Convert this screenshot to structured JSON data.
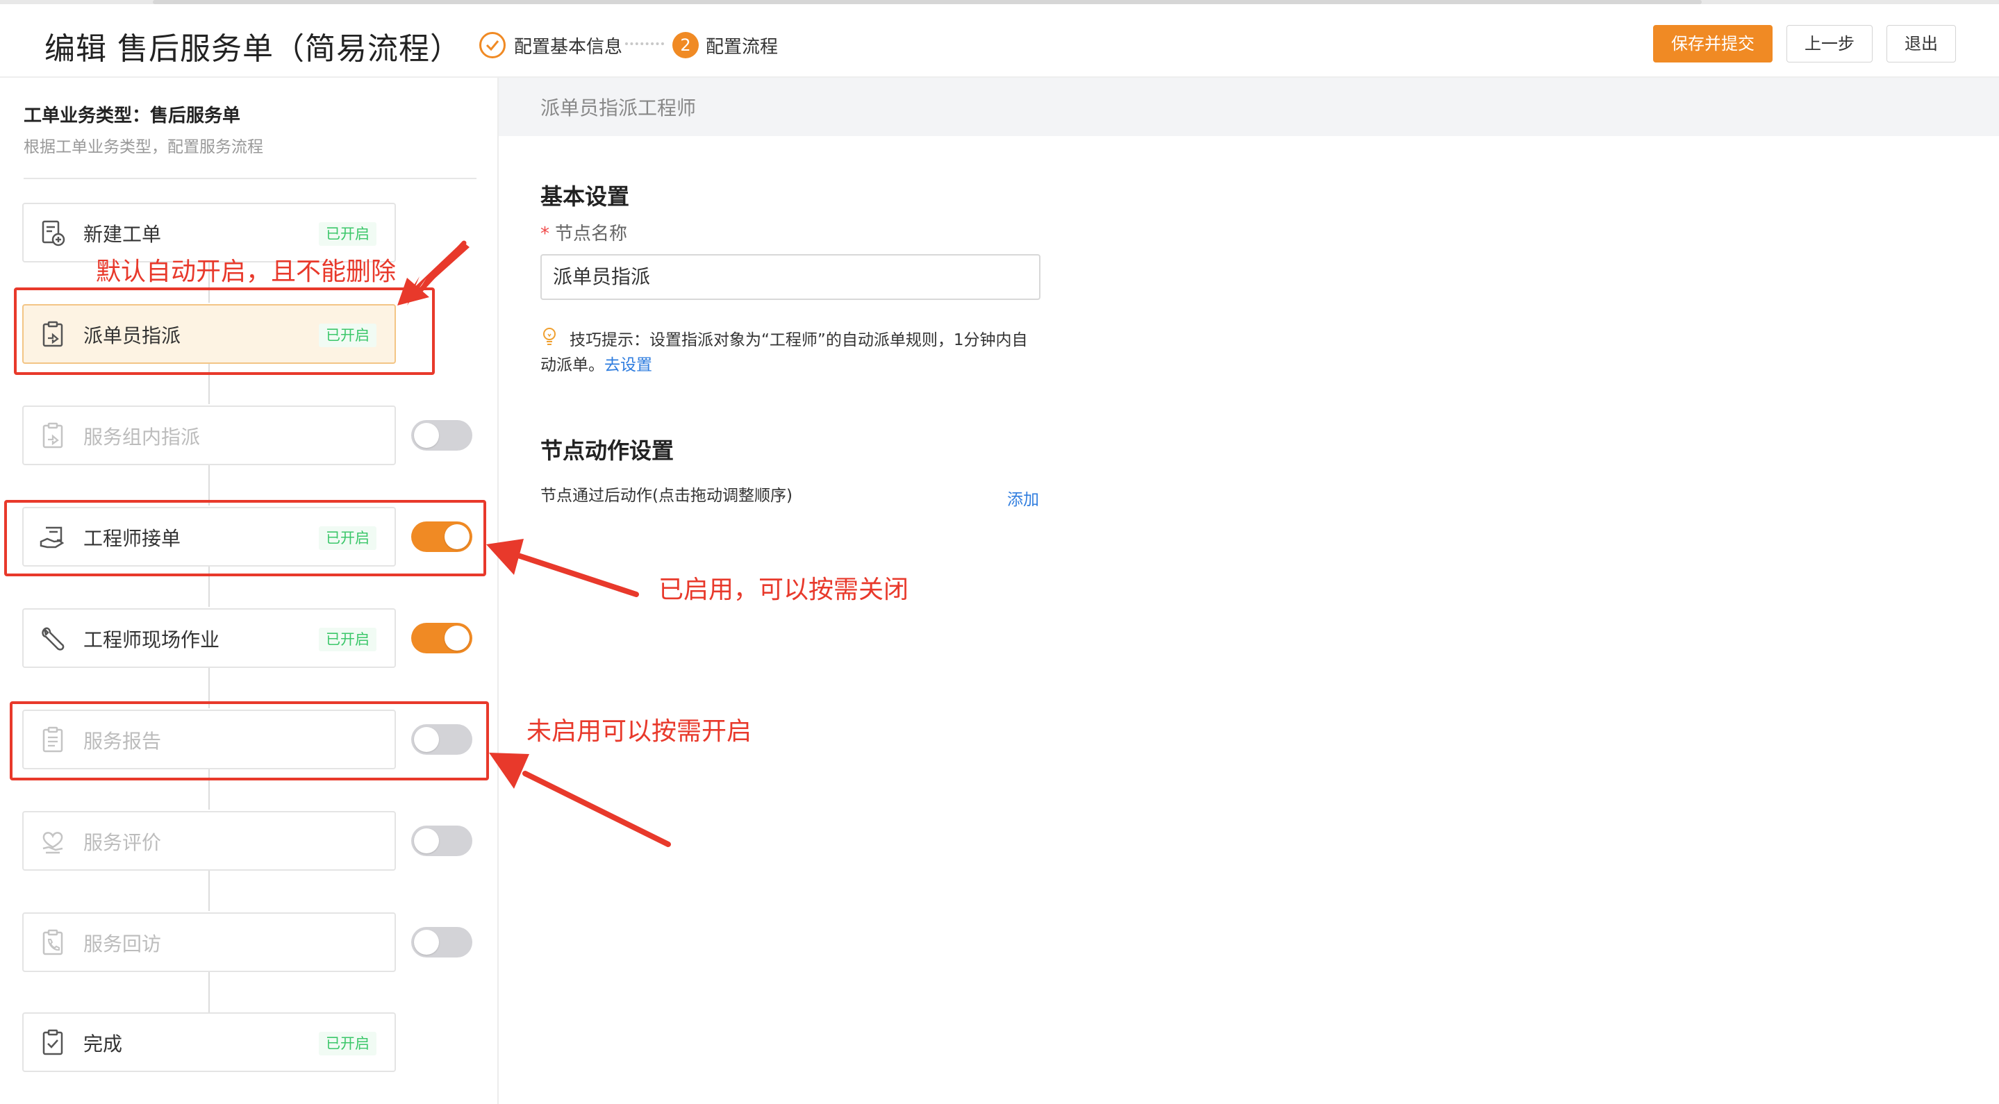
{
  "page_title": "编辑 售后服务单（简易流程）",
  "steps": [
    {
      "label": "配置基本信息",
      "state": "done",
      "icon": "check-circle-icon"
    },
    {
      "label": "配置流程",
      "state": "current",
      "number": "2"
    }
  ],
  "toolbar": {
    "save_submit": "保存并提交",
    "prev": "上一步",
    "exit": "退出"
  },
  "sidebar": {
    "title": "工单业务类型：售后服务单",
    "subtitle": "根据工单业务类型，配置服务流程",
    "nodes": [
      {
        "name": "新建工单",
        "badge": "已开启",
        "enabled": true,
        "icon": "new-ticket-icon"
      },
      {
        "name": "派单员指派",
        "badge": "已开启",
        "enabled": true,
        "selected": true,
        "icon": "dispatch-icon"
      },
      {
        "name": "服务组内指派",
        "enabled": false,
        "toggle": "off",
        "icon": "group-dispatch-icon"
      },
      {
        "name": "工程师接单",
        "badge": "已开启",
        "enabled": true,
        "toggle": "on",
        "icon": "accept-order-icon"
      },
      {
        "name": "工程师现场作业",
        "badge": "已开启",
        "enabled": true,
        "toggle": "on",
        "icon": "wrench-icon"
      },
      {
        "name": "服务报告",
        "enabled": false,
        "toggle": "off",
        "icon": "report-icon"
      },
      {
        "name": "服务评价",
        "enabled": false,
        "toggle": "off",
        "icon": "rating-icon"
      },
      {
        "name": "服务回访",
        "enabled": false,
        "toggle": "off",
        "icon": "phone-visit-icon"
      },
      {
        "name": "完成",
        "badge": "已开启",
        "enabled": true,
        "icon": "complete-icon"
      }
    ]
  },
  "detail": {
    "header": "派单员指派工程师",
    "basic_title": "基本设置",
    "node_name_label": "节点名称",
    "node_name_value": "派单员指派",
    "tip_line1": "技巧提示：设置指派对象为“工程师”的自动派单规则，1分钟内自",
    "tip_line2": "动派单。",
    "tip_link": "去设置",
    "actions_title": "节点动作设置",
    "actions_label": "节点通过后动作(点击拖动调整顺序)",
    "add": "添加"
  },
  "annotations": [
    "默认自动开启，且不能删除",
    "已启用，可以按需关闭",
    "未启用可以按需开启"
  ],
  "colors": {
    "accent": "#f08a24",
    "annotation": "#e8392b",
    "badge_green": "#3cc76a",
    "link": "#2f7ddf"
  }
}
